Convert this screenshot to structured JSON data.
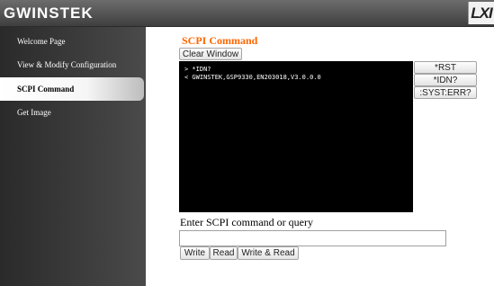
{
  "header": {
    "brand": "GWINSTEK",
    "lxi_logo": "LXI"
  },
  "sidebar": {
    "items": [
      {
        "label": "Welcome Page"
      },
      {
        "label": "View & Modify Configuration"
      },
      {
        "label": "SCPI Command",
        "active": true
      },
      {
        "label": "Get Image"
      }
    ]
  },
  "main": {
    "title": "SCPI Command",
    "clear_button": "Clear Window",
    "console_lines": [
      "> *IDN?",
      "< GWINSTEK,GSP9330,EN203018,V3.0.0.0"
    ],
    "side_buttons": [
      "*RST",
      "*IDN?",
      ":SYST:ERR?"
    ],
    "input_label": "Enter SCPI command or query",
    "input_value": "",
    "action_buttons": [
      "Write",
      "Read",
      "Write & Read"
    ]
  },
  "colors": {
    "accent": "#ff6600",
    "console_bg": "#000000",
    "header_bg": "#4a4a4a"
  }
}
